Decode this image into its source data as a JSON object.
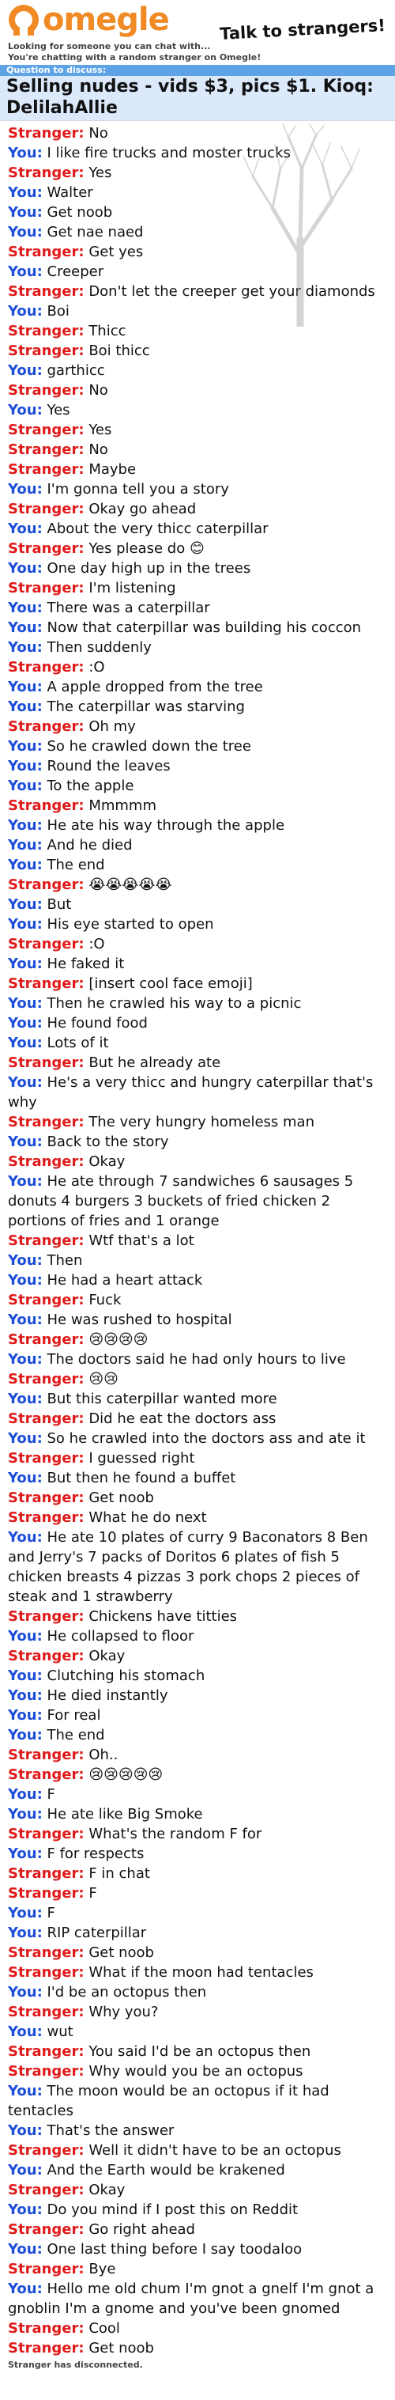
{
  "header": {
    "logo_text": "omegle",
    "tagline": "Talk to strangers!"
  },
  "status_lines": [
    "Looking for someone you can chat with...",
    "You're chatting with a random stranger on Omegle!"
  ],
  "question": {
    "label": "Question to discuss:",
    "text": "Selling nudes - vids $3, pics $1. Kioq: DelilahAllie"
  },
  "speakers": {
    "stranger": "Stranger:",
    "you": "You:"
  },
  "messages": [
    {
      "from": "stranger",
      "text": "No"
    },
    {
      "from": "you",
      "text": "I like fire trucks and moster trucks"
    },
    {
      "from": "stranger",
      "text": "Yes"
    },
    {
      "from": "you",
      "text": "Walter"
    },
    {
      "from": "you",
      "text": "Get noob"
    },
    {
      "from": "you",
      "text": "Get nae naed"
    },
    {
      "from": "stranger",
      "text": "Get yes"
    },
    {
      "from": "you",
      "text": "Creeper"
    },
    {
      "from": "stranger",
      "text": "Don't let the creeper get your diamonds"
    },
    {
      "from": "you",
      "text": "Boi"
    },
    {
      "from": "stranger",
      "text": "Thicc"
    },
    {
      "from": "stranger",
      "text": "Boi thicc"
    },
    {
      "from": "you",
      "text": "garthicc"
    },
    {
      "from": "stranger",
      "text": "No"
    },
    {
      "from": "you",
      "text": "Yes"
    },
    {
      "from": "stranger",
      "text": "Yes"
    },
    {
      "from": "stranger",
      "text": "No"
    },
    {
      "from": "stranger",
      "text": "Maybe"
    },
    {
      "from": "you",
      "text": "I'm gonna tell you a story"
    },
    {
      "from": "stranger",
      "text": "Okay go ahead"
    },
    {
      "from": "you",
      "text": "About the very thicc caterpillar"
    },
    {
      "from": "stranger",
      "text": "Yes please do 😊"
    },
    {
      "from": "you",
      "text": "One day high up in the trees"
    },
    {
      "from": "stranger",
      "text": "I'm listening"
    },
    {
      "from": "you",
      "text": "There was a caterpillar"
    },
    {
      "from": "you",
      "text": "Now that caterpillar was building his coccon"
    },
    {
      "from": "you",
      "text": "Then suddenly"
    },
    {
      "from": "stranger",
      "text": ":O"
    },
    {
      "from": "you",
      "text": "A apple dropped from the tree"
    },
    {
      "from": "you",
      "text": "The caterpillar was starving"
    },
    {
      "from": "stranger",
      "text": "Oh my"
    },
    {
      "from": "you",
      "text": "So he crawled down the tree"
    },
    {
      "from": "you",
      "text": "Round the leaves"
    },
    {
      "from": "you",
      "text": "To the apple"
    },
    {
      "from": "stranger",
      "text": "Mmmmm"
    },
    {
      "from": "you",
      "text": "He ate his way through the apple"
    },
    {
      "from": "you",
      "text": "And he died"
    },
    {
      "from": "you",
      "text": "The end"
    },
    {
      "from": "stranger",
      "text": "😭😭😭😭😭"
    },
    {
      "from": "you",
      "text": "But"
    },
    {
      "from": "you",
      "text": "His eye started to open"
    },
    {
      "from": "stranger",
      "text": ":O"
    },
    {
      "from": "you",
      "text": "He faked it"
    },
    {
      "from": "stranger",
      "text": "[insert cool face emoji]"
    },
    {
      "from": "you",
      "text": "Then he crawled his way to a picnic"
    },
    {
      "from": "you",
      "text": "He found food"
    },
    {
      "from": "you",
      "text": "Lots of it"
    },
    {
      "from": "stranger",
      "text": "But he already ate"
    },
    {
      "from": "you",
      "text": "He's a very thicc and hungry caterpillar that's why"
    },
    {
      "from": "stranger",
      "text": "The very hungry homeless man"
    },
    {
      "from": "you",
      "text": "Back to the story"
    },
    {
      "from": "stranger",
      "text": "Okay"
    },
    {
      "from": "you",
      "text": "He ate through 7 sandwiches 6 sausages 5 donuts 4 burgers 3 buckets of fried chicken 2 portions of fries and 1 orange"
    },
    {
      "from": "stranger",
      "text": "Wtf that's a lot"
    },
    {
      "from": "you",
      "text": "Then"
    },
    {
      "from": "you",
      "text": "He had a heart attack"
    },
    {
      "from": "stranger",
      "text": "Fuck"
    },
    {
      "from": "you",
      "text": "He was rushed to hospital"
    },
    {
      "from": "stranger",
      "text": "😢😢😢😢"
    },
    {
      "from": "you",
      "text": "The doctors said he had only hours to live"
    },
    {
      "from": "stranger",
      "text": "😢😢"
    },
    {
      "from": "you",
      "text": "But this caterpillar wanted more"
    },
    {
      "from": "stranger",
      "text": "Did he eat the doctors ass"
    },
    {
      "from": "you",
      "text": "So he crawled into the doctors ass and ate it"
    },
    {
      "from": "stranger",
      "text": "I guessed right"
    },
    {
      "from": "you",
      "text": "But then he found a buffet"
    },
    {
      "from": "stranger",
      "text": "Get noob"
    },
    {
      "from": "stranger",
      "text": "What he do next"
    },
    {
      "from": "you",
      "text": "He ate 10 plates of curry 9 Baconators 8 Ben and Jerry's 7 packs of Doritos 6 plates of fish 5 chicken breasts 4 pizzas 3 pork chops 2 pieces of steak and 1 strawberry"
    },
    {
      "from": "stranger",
      "text": "Chickens have titties"
    },
    {
      "from": "you",
      "text": "He collapsed to floor"
    },
    {
      "from": "stranger",
      "text": "Okay"
    },
    {
      "from": "you",
      "text": "Clutching his stomach"
    },
    {
      "from": "you",
      "text": "He died instantly"
    },
    {
      "from": "you",
      "text": "For real"
    },
    {
      "from": "you",
      "text": "The end"
    },
    {
      "from": "stranger",
      "text": "Oh.."
    },
    {
      "from": "stranger",
      "text": "😢😢😢😢😢"
    },
    {
      "from": "you",
      "text": "F"
    },
    {
      "from": "you",
      "text": "He ate like Big Smoke"
    },
    {
      "from": "stranger",
      "text": "What's the random F for"
    },
    {
      "from": "you",
      "text": "F for respects"
    },
    {
      "from": "stranger",
      "text": "F in chat"
    },
    {
      "from": "stranger",
      "text": "F"
    },
    {
      "from": "you",
      "text": "F"
    },
    {
      "from": "you",
      "text": "RIP caterpillar"
    },
    {
      "from": "stranger",
      "text": "Get noob"
    },
    {
      "from": "stranger",
      "text": "What if the moon had tentacles"
    },
    {
      "from": "you",
      "text": "I'd be an octopus then"
    },
    {
      "from": "stranger",
      "text": "Why you?"
    },
    {
      "from": "you",
      "text": "wut"
    },
    {
      "from": "stranger",
      "text": "You said I'd be an octopus then"
    },
    {
      "from": "stranger",
      "text": "Why would you be an octopus"
    },
    {
      "from": "you",
      "text": "The moon would be an octopus if it had tentacles"
    },
    {
      "from": "you",
      "text": "That's the answer"
    },
    {
      "from": "stranger",
      "text": "Well it didn't have to be an octopus"
    },
    {
      "from": "you",
      "text": "And the Earth would be krakened"
    },
    {
      "from": "stranger",
      "text": "Okay"
    },
    {
      "from": "you",
      "text": "Do you mind if I post this on Reddit"
    },
    {
      "from": "stranger",
      "text": "Go right ahead"
    },
    {
      "from": "you",
      "text": "One last thing before I say toodaloo"
    },
    {
      "from": "stranger",
      "text": "Bye"
    },
    {
      "from": "you",
      "text": "Hello me old chum I'm gnot a gnelf I'm gnot a gnoblin I'm a gnome and you've been gnomed"
    },
    {
      "from": "stranger",
      "text": "Cool"
    },
    {
      "from": "stranger",
      "text": "Get noob"
    }
  ],
  "disconnect_text": "Stranger has disconnected.",
  "colors": {
    "brand_orange": "#f08a24",
    "stranger_red": "#e01a1a",
    "you_blue": "#1d4ed8",
    "question_bar": "#5ea3e6",
    "question_bg": "#dbe9fb"
  },
  "icons": {
    "logo": "omegle-logo-icon",
    "background_decoration": "bare-tree-illustration"
  }
}
